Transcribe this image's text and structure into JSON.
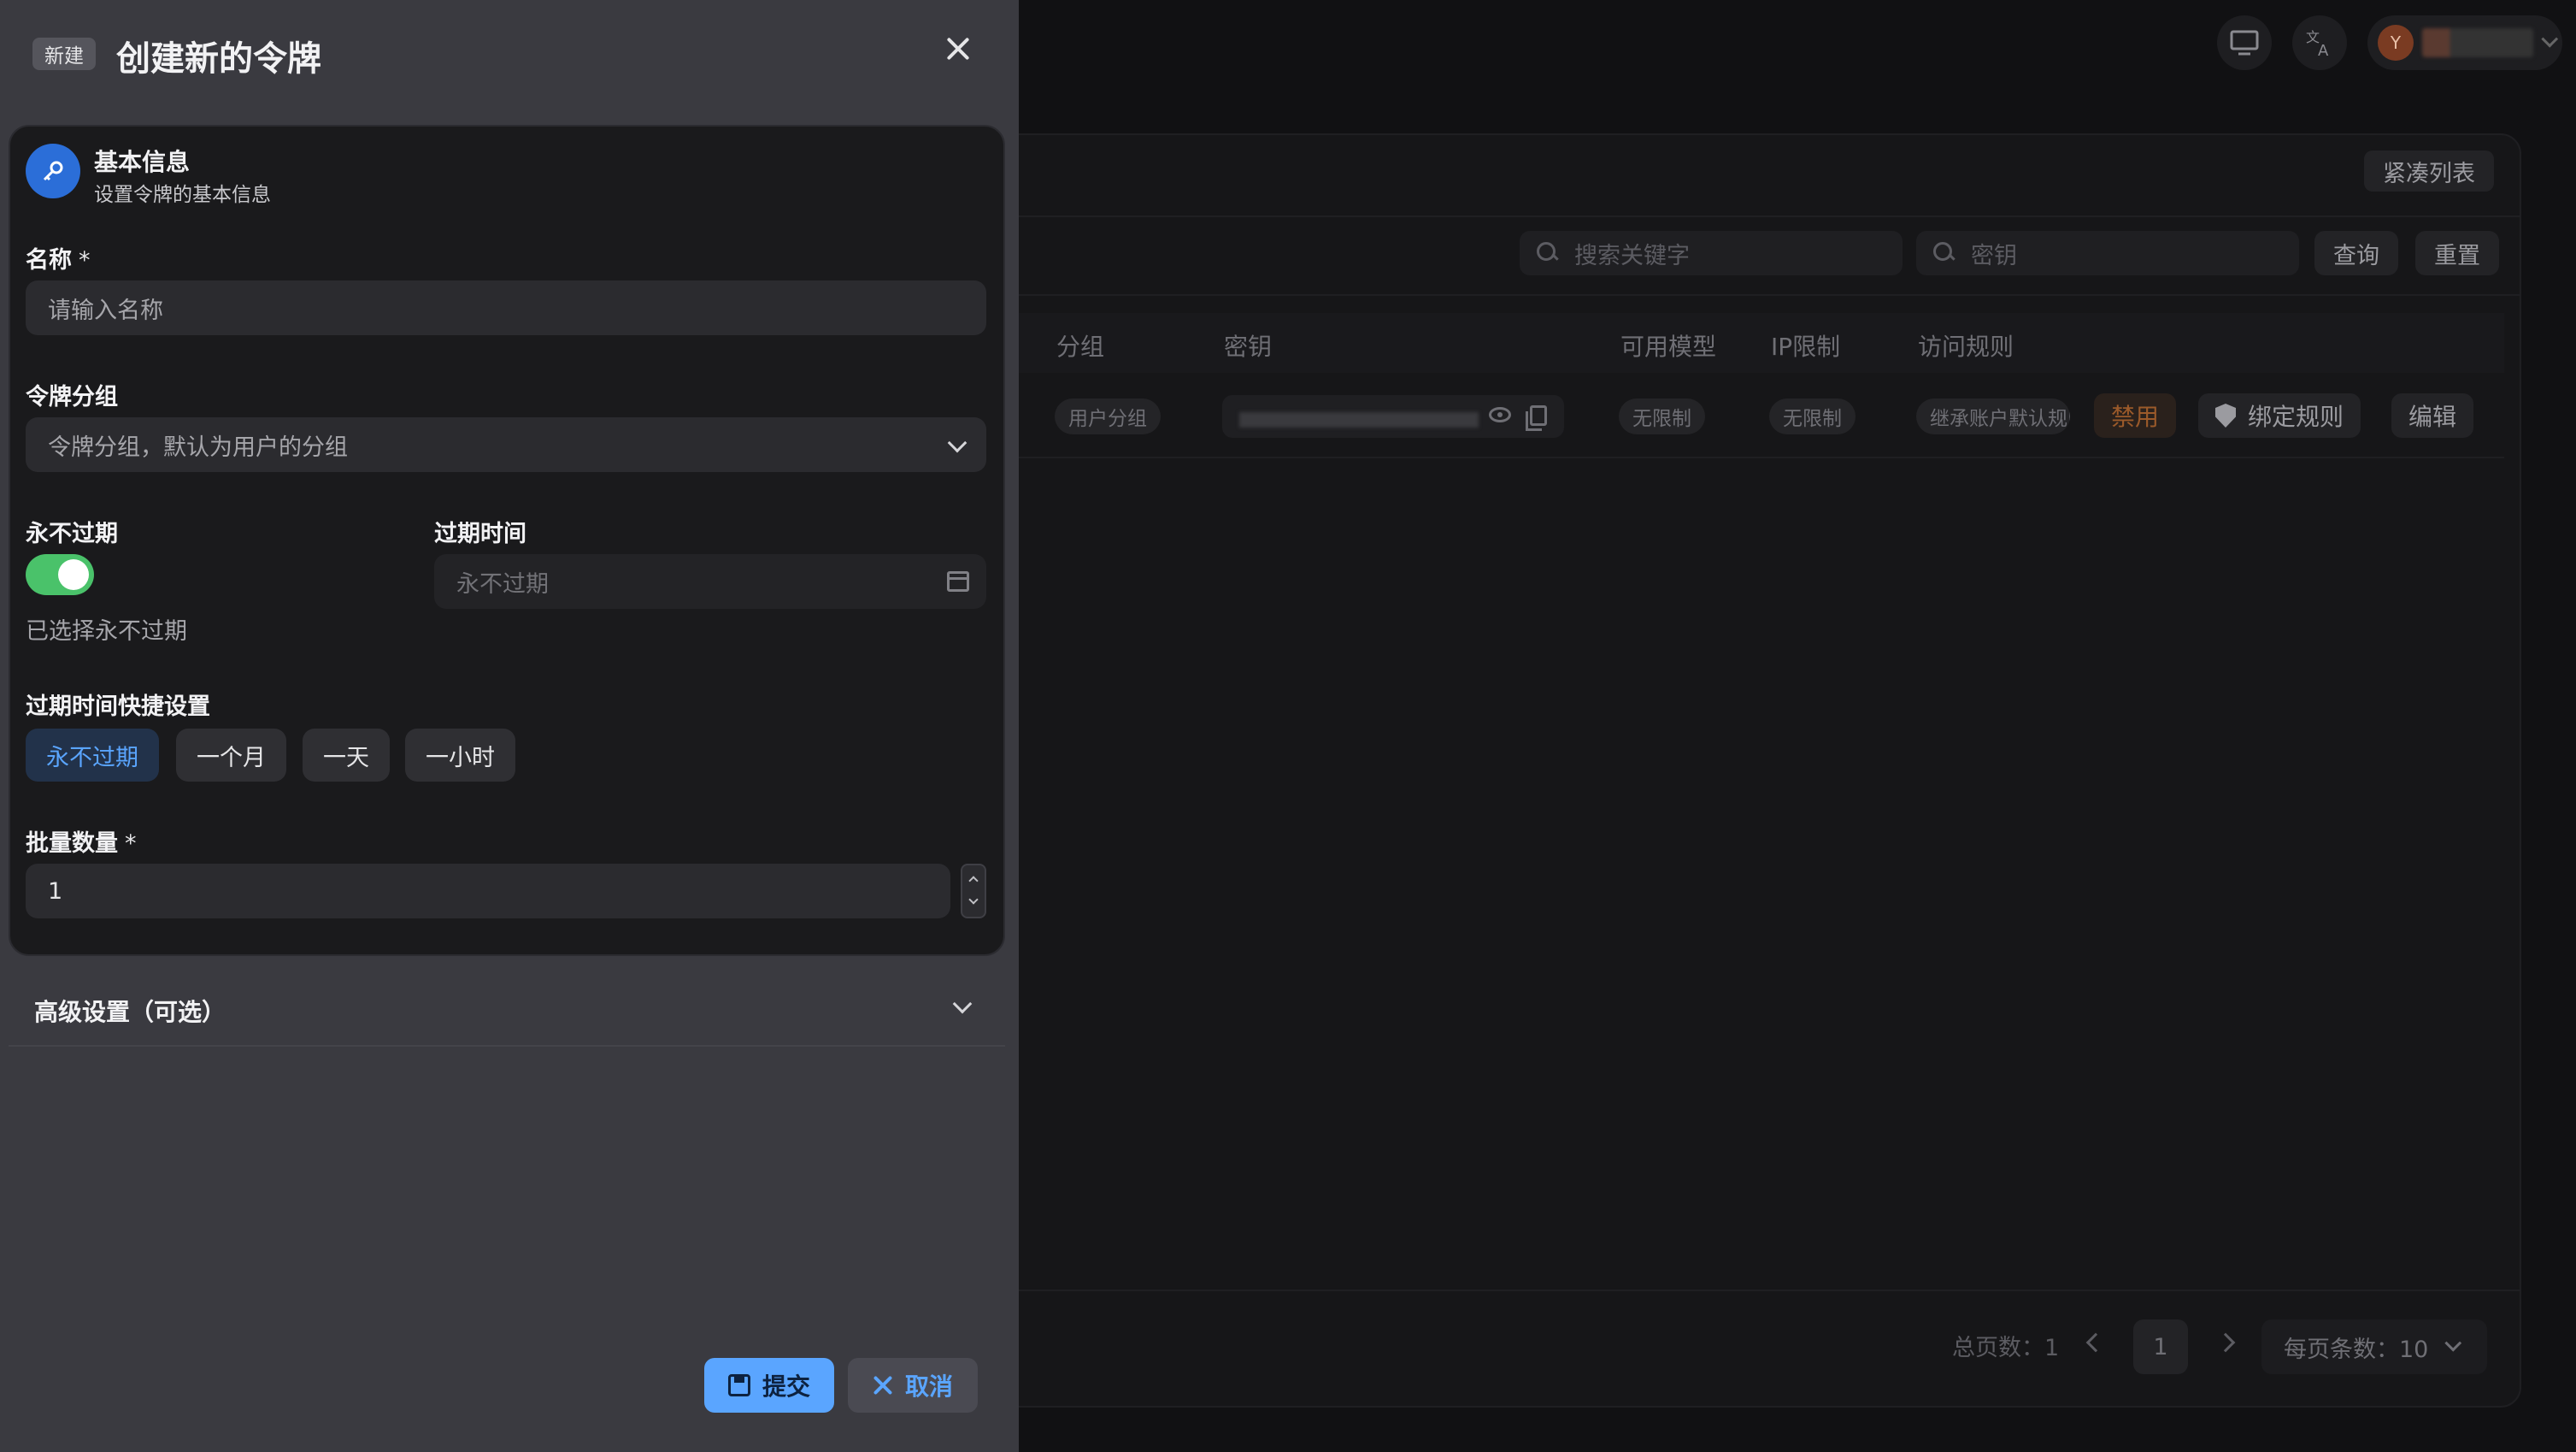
{
  "topbar": {
    "display_icon": "monitor-icon",
    "language_icon": "translate-icon",
    "user_initial": "Y"
  },
  "main": {
    "compact_list_label": "紧凑列表",
    "search_keyword_placeholder": "搜索关键字",
    "search_key_placeholder": "密钥",
    "query_label": "查询",
    "reset_label": "重置",
    "columns": [
      "分组",
      "密钥",
      "可用模型",
      "IP限制",
      "访问规则"
    ],
    "row": {
      "group": "用户分组",
      "models": "无限制",
      "ip_limit": "无限制",
      "access_rule": "继承账户默认规则",
      "disable_label": "禁用",
      "bind_rule_label": "绑定规则",
      "edit_label": "编辑"
    },
    "pagination": {
      "total_label": "总页数：1",
      "current_page": "1",
      "per_page_label": "每页条数：10"
    }
  },
  "sheet": {
    "badge": "新建",
    "title": "创建新的令牌",
    "section": {
      "title": "基本信息",
      "subtitle": "设置令牌的基本信息",
      "icon": "key-icon"
    },
    "name": {
      "label": "名称",
      "required": "*",
      "placeholder": "请输入名称"
    },
    "group": {
      "label": "令牌分组",
      "placeholder": "令牌分组，默认为用户的分组"
    },
    "never_expire": {
      "label": "永不过期",
      "enabled": true,
      "hint": "已选择永不过期"
    },
    "expire_time": {
      "label": "过期时间",
      "placeholder": "永不过期"
    },
    "quick": {
      "label": "过期时间快捷设置",
      "options": [
        "永不过期",
        "一个月",
        "一天",
        "一小时"
      ],
      "active_index": 0
    },
    "batch": {
      "label": "批量数量",
      "required": "*",
      "value": "1"
    },
    "advanced_label": "高级设置（可选）",
    "submit_label": "提交",
    "cancel_label": "取消"
  },
  "colors": {
    "accent": "#5aa5ff",
    "toggle_on": "#4ac26a",
    "section_icon_bg": "#2b6ed8"
  }
}
